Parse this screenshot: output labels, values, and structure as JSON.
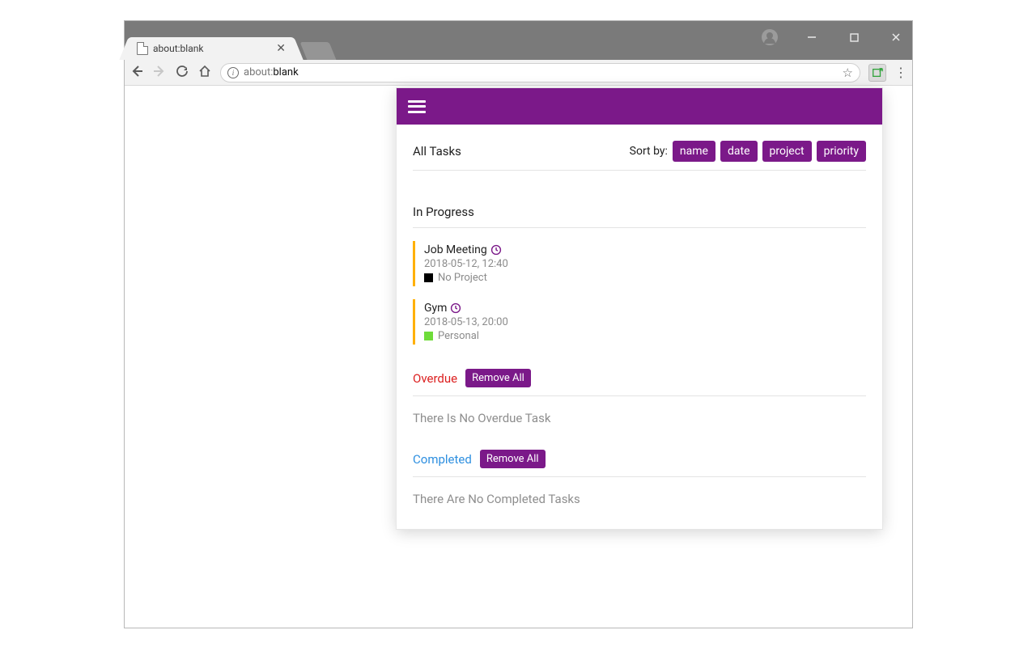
{
  "browser": {
    "tab_title": "about:blank",
    "address": "about:blank",
    "address_prefix": "about:"
  },
  "header": {
    "all_tasks": "All Tasks",
    "sort_by": "Sort by:",
    "sorts": {
      "name": "name",
      "date": "date",
      "project": "project",
      "priority": "priority"
    }
  },
  "sections": {
    "in_progress": {
      "title": "In Progress",
      "tasks": [
        {
          "title": "Job Meeting",
          "datetime": "2018-05-12, 12:40",
          "project": "No Project",
          "swatch": "#000000"
        },
        {
          "title": "Gym",
          "datetime": "2018-05-13, 20:00",
          "project": "Personal",
          "swatch": "#6fdc3a"
        }
      ]
    },
    "overdue": {
      "title": "Overdue",
      "remove_all": "Remove All",
      "empty": "There Is No Overdue Task"
    },
    "completed": {
      "title": "Completed",
      "remove_all": "Remove All",
      "empty": "There Are No Completed Tasks"
    }
  }
}
